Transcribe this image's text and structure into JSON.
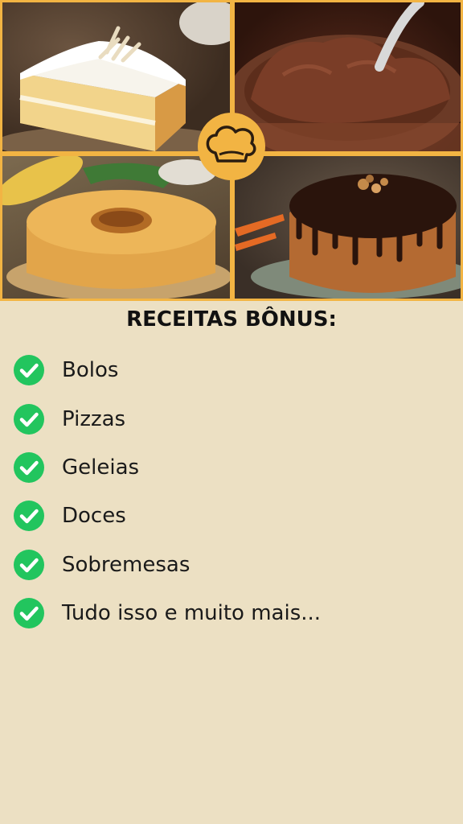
{
  "title": "RECEITAS BÔNUS:",
  "items": [
    {
      "label": "Bolos"
    },
    {
      "label": "Pizzas"
    },
    {
      "label": "Geleias"
    },
    {
      "label": "Doces"
    },
    {
      "label": "Sobremesas"
    },
    {
      "label": "Tudo isso e muito mais..."
    }
  ],
  "colors": {
    "background": "#ece0c3",
    "frame": "#f2b443",
    "check": "#22c55e"
  },
  "icons": {
    "badge": "chef-hat-icon",
    "bullet": "check-circle-icon"
  }
}
